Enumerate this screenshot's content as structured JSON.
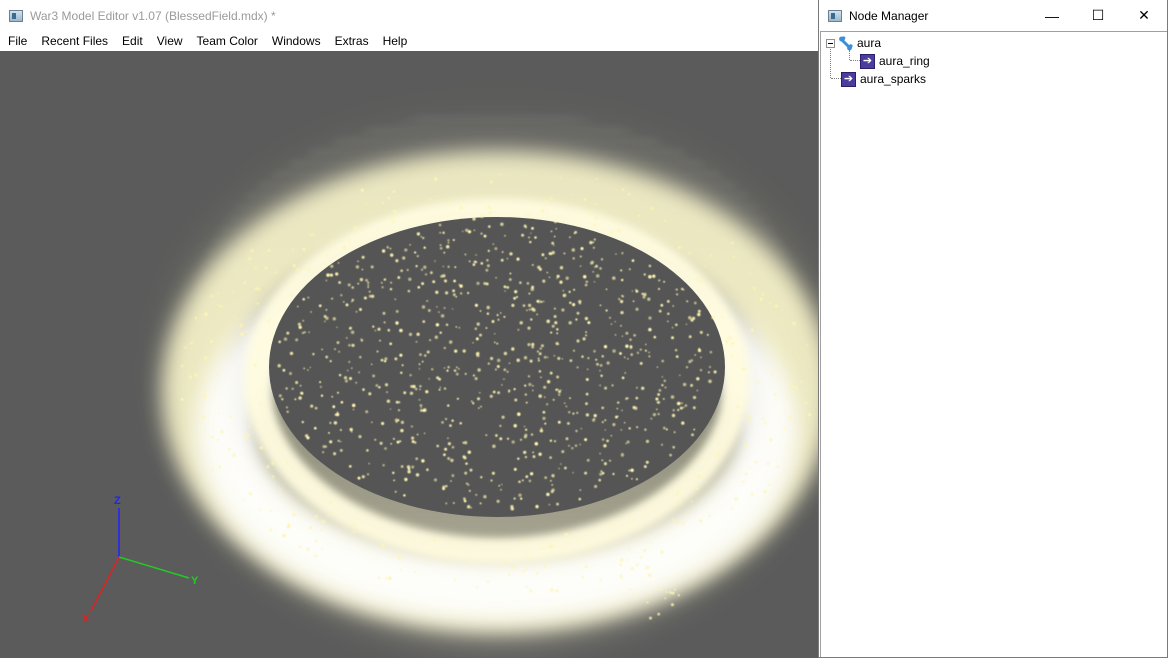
{
  "main_window": {
    "title": "War3 Model Editor v1.07 (BlessedField.mdx) *",
    "menu": [
      "File",
      "Recent Files",
      "Edit",
      "View",
      "Team Color",
      "Windows",
      "Extras",
      "Help"
    ]
  },
  "axes": {
    "z_label": "Z",
    "y_label": "Y",
    "x_label": "X",
    "z_color": "#2222ff",
    "y_color": "#22cc22",
    "x_color": "#dd2222"
  },
  "node_manager": {
    "title": "Node Manager",
    "controls": {
      "minimize": "—",
      "maximize": "☐",
      "close": "✕"
    },
    "nodes": [
      {
        "label": "aura",
        "icon": "bone-icon",
        "depth": 0,
        "expanded": true
      },
      {
        "label": "aura_ring",
        "icon": "particle-emitter-icon",
        "depth": 1
      },
      {
        "label": "aura_sparks",
        "icon": "particle-emitter-icon",
        "depth": 0
      }
    ]
  },
  "colors": {
    "viewport_bg": "#5b5b5b",
    "glow": "#fffbd0",
    "glow_edge": "#e8e6a8"
  }
}
